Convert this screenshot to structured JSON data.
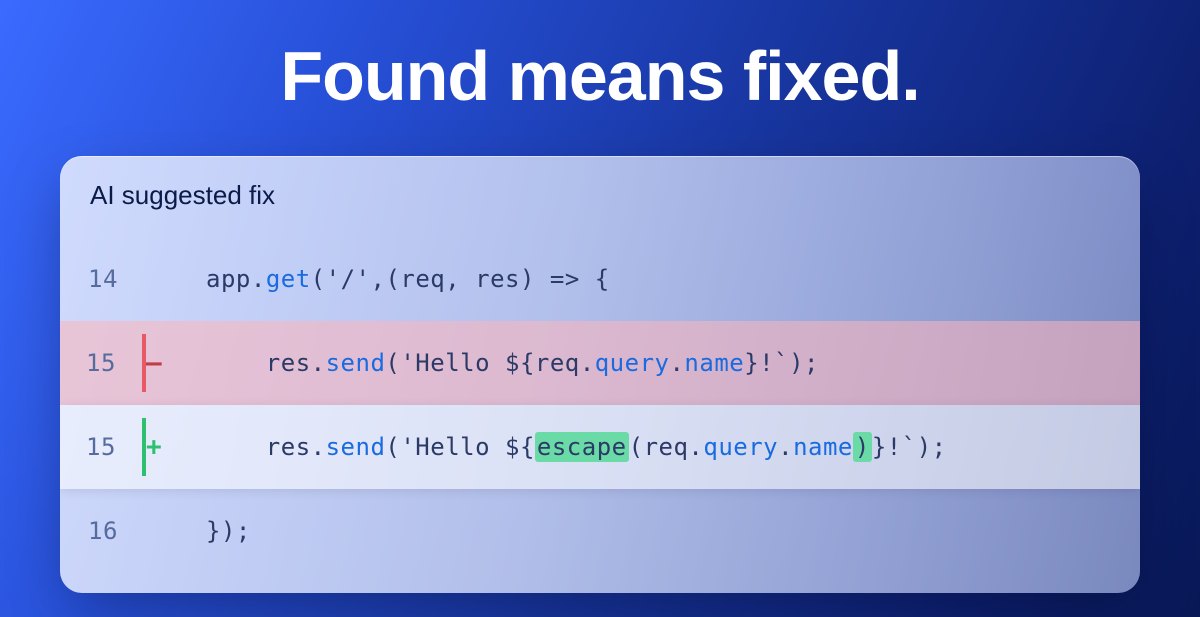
{
  "headline": "Found means fixed.",
  "card": {
    "title": "AI suggested fix",
    "lines": {
      "l14": {
        "no": "14"
      },
      "l15_removed": {
        "no": "15",
        "marker": "–"
      },
      "l15_added": {
        "no": "15",
        "marker": "+"
      },
      "l16": {
        "no": "16"
      }
    },
    "code": {
      "l14": {
        "app": "app",
        "dot1": ".",
        "get": "get",
        "open": "(",
        "path": "'/'",
        "comma": ",",
        "params": "(req, res)",
        "arrow": " => ",
        "brace": "{"
      },
      "removed": {
        "indent": "    ",
        "res": "res",
        "dot": ".",
        "send": "send",
        "open": "(",
        "strOpen": "'Hello ${",
        "req": "req",
        "dot2": ".",
        "query": "query",
        "dot3": ".",
        "name": "name",
        "strClose": "}!`",
        "close": ");"
      },
      "added": {
        "indent": "    ",
        "res": "res",
        "dot": ".",
        "send": "send",
        "open": "(",
        "strOpen": "'Hello ${",
        "escape": "escape",
        "escOpen": "(",
        "req": "req",
        "dot2": ".",
        "query": "query",
        "dot3": ".",
        "name": "name",
        "escClose": ")",
        "strClose": "}!`",
        "close": ");"
      },
      "l16": {
        "close": "});"
      }
    }
  }
}
